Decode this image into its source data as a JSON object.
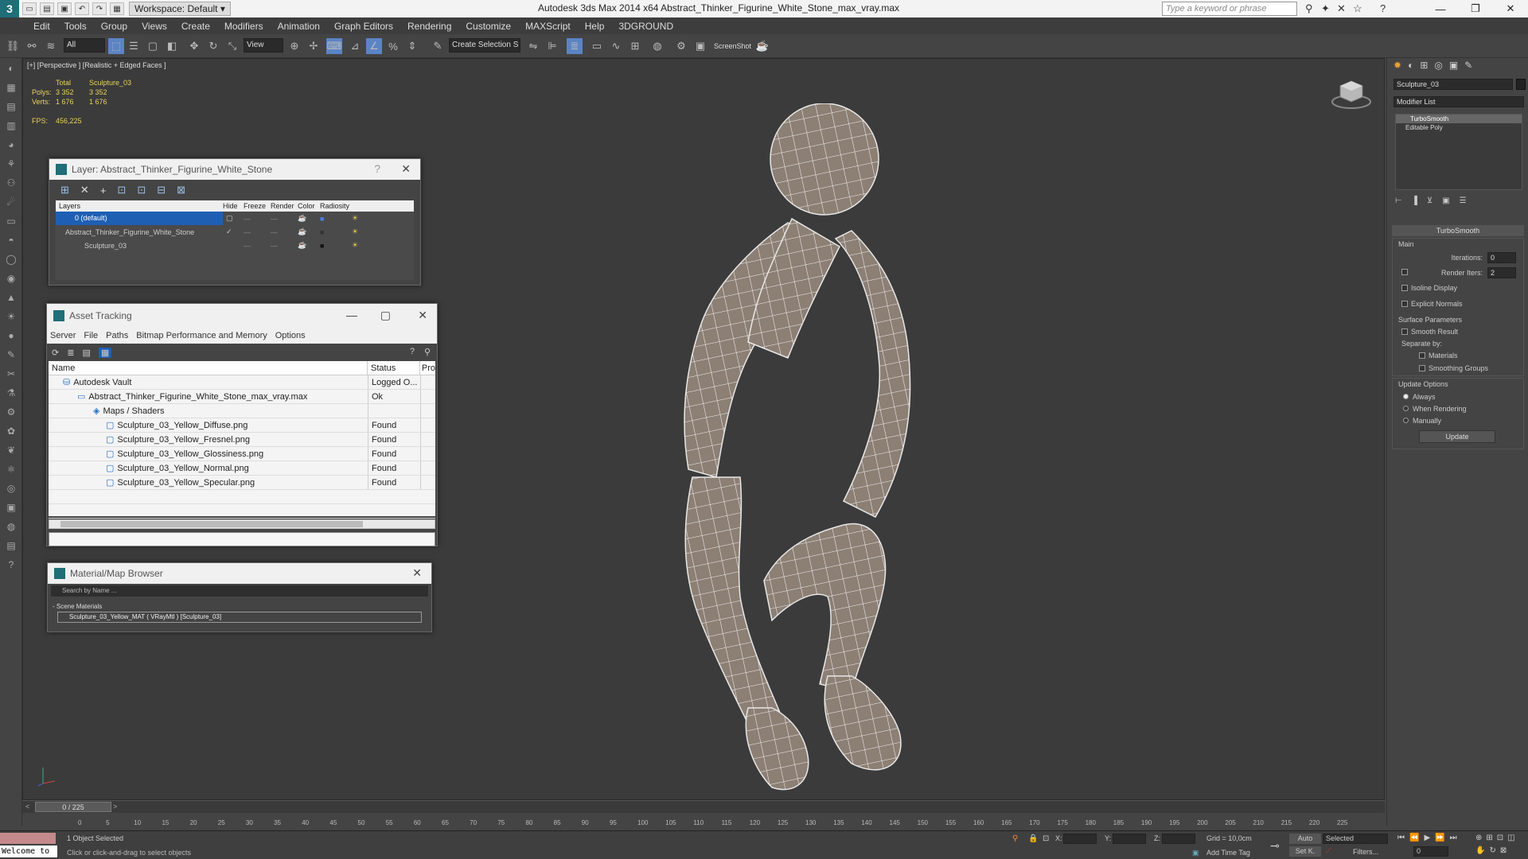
{
  "titlebar": {
    "workspace": "Workspace: Default",
    "app_title": "Autodesk 3ds Max  2014 x64    Abstract_Thinker_Figurine_White_Stone_max_vray.max",
    "search_placeholder": "Type a keyword or phrase"
  },
  "menu": [
    "Edit",
    "Tools",
    "Group",
    "Views",
    "Create",
    "Modifiers",
    "Animation",
    "Graph Editors",
    "Rendering",
    "Customize",
    "MAXScript",
    "Help",
    "3DGROUND"
  ],
  "toolbar": {
    "filter": "All",
    "refcoord": "View",
    "selset": "Create Selection S",
    "screenshot": "ScreenShot"
  },
  "viewport": {
    "label": "[+] [Perspective ] [Realistic + Edged Faces ]",
    "stats": {
      "col1": "Total",
      "col2": "Sculpture_03",
      "polys_label": "Polys:",
      "polys_total": "3 352",
      "polys_sel": "3 352",
      "verts_label": "Verts:",
      "verts_total": "1 676",
      "verts_sel": "1 676",
      "fps_label": "FPS:",
      "fps_value": "456,225"
    }
  },
  "layer_dialog": {
    "title": "Layer: Abstract_Thinker_Figurine_White_Stone",
    "headers": [
      "Layers",
      "Hide",
      "Freeze",
      "Render",
      "Color",
      "Radiosity"
    ],
    "rows": [
      "0 (default)",
      "Abstract_Thinker_Figurine_White_Stone",
      "Sculpture_03"
    ]
  },
  "asset_dialog": {
    "title": "Asset Tracking",
    "menu": [
      "Server",
      "File",
      "Paths",
      "Bitmap Performance and Memory",
      "Options"
    ],
    "headers": [
      "Name",
      "Status",
      "Pro"
    ],
    "rows": [
      {
        "name": "Autodesk Vault",
        "status": "Logged O..."
      },
      {
        "name": "Abstract_Thinker_Figurine_White_Stone_max_vray.max",
        "status": "Ok"
      },
      {
        "name": "Maps / Shaders",
        "status": ""
      },
      {
        "name": "Sculpture_03_Yellow_Diffuse.png",
        "status": "Found"
      },
      {
        "name": "Sculpture_03_Yellow_Fresnel.png",
        "status": "Found"
      },
      {
        "name": "Sculpture_03_Yellow_Glossiness.png",
        "status": "Found"
      },
      {
        "name": "Sculpture_03_Yellow_Normal.png",
        "status": "Found"
      },
      {
        "name": "Sculpture_03_Yellow_Specular.png",
        "status": "Found"
      }
    ]
  },
  "material_dialog": {
    "title": "Material/Map Browser",
    "search": "Search by Name ...",
    "section": "- Scene Materials",
    "item": "Sculpture_03_Yellow_MAT ( VRayMtl ) [Sculpture_03]"
  },
  "right_panel": {
    "object_name": "Sculpture_03",
    "modifier_list": "Modifier List",
    "stack": [
      "TurboSmooth",
      "Editable Poly"
    ],
    "rollout": "TurboSmooth",
    "main": "Main",
    "iterations_label": "Iterations:",
    "iterations": "0",
    "render_iters_label": "Render Iters:",
    "render_iters": "2",
    "isoline": "Isoline Display",
    "explicit": "Explicit Normals",
    "surface": "Surface Parameters",
    "smooth": "Smooth Result",
    "separate": "Separate by:",
    "materials": "Materials",
    "smoothing": "Smoothing Groups",
    "update_opts": "Update Options",
    "always": "Always",
    "when_rendering": "When Rendering",
    "manually": "Manually",
    "update_btn": "Update"
  },
  "timeline": {
    "frame": "0 / 225",
    "ticks": [
      "0",
      "5",
      "10",
      "15",
      "20",
      "25",
      "30",
      "35",
      "40",
      "45",
      "50",
      "55",
      "60",
      "65",
      "70",
      "75",
      "80",
      "85",
      "90",
      "95",
      "100",
      "105",
      "110",
      "115",
      "120",
      "125",
      "130",
      "135",
      "140",
      "145",
      "150",
      "155",
      "160",
      "165",
      "170",
      "175",
      "180",
      "185",
      "190",
      "195",
      "200",
      "205",
      "210",
      "215",
      "220",
      "225"
    ]
  },
  "status": {
    "welcome": "Welcome to",
    "selected": "1 Object Selected",
    "hint": "Click or click-and-drag to select objects",
    "x_label": "X:",
    "y_label": "Y:",
    "z_label": "Z:",
    "grid": "Grid = 10,0cm",
    "add_time_tag": "Add Time Tag",
    "auto": "Auto",
    "selected_dd": "Selected",
    "setk": "Set K.",
    "filters": "Filters...",
    "frame_field": "0"
  },
  "colors": {
    "accent": "#1f6e78",
    "stats": "#e8d25a",
    "selection": "#1e5fb4"
  }
}
